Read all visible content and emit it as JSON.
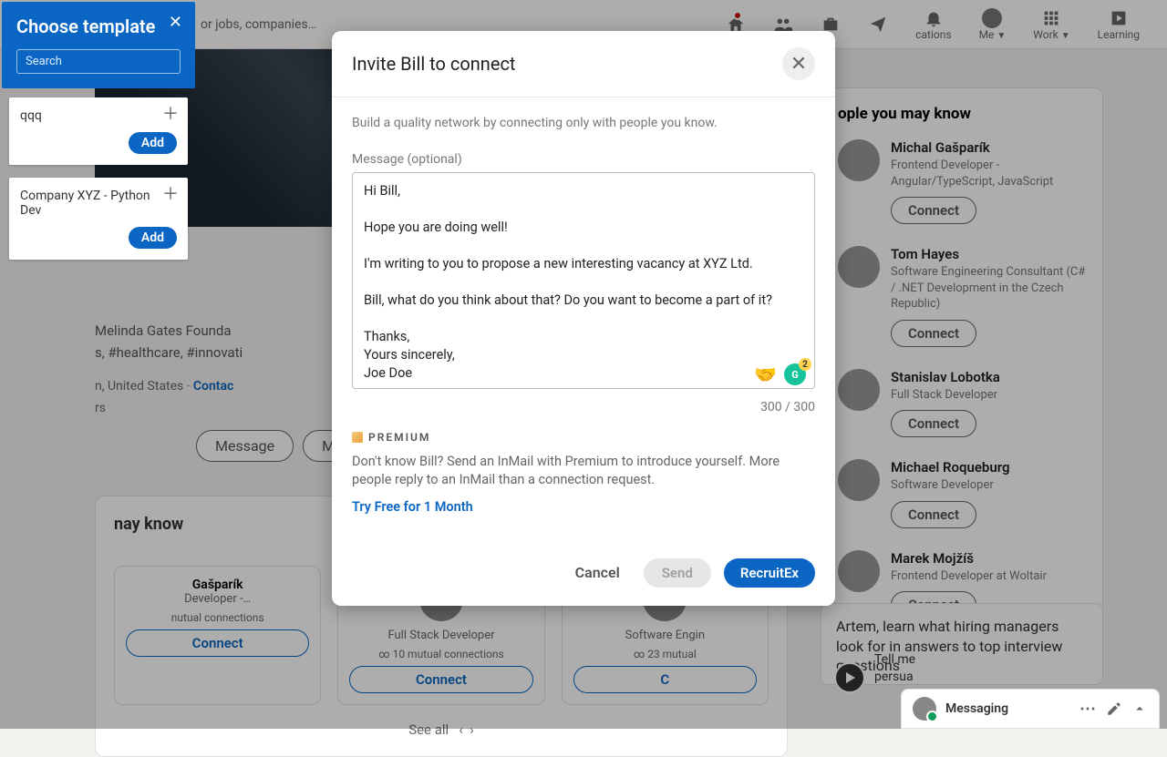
{
  "topnav": {
    "search_hint": "or jobs, companies…",
    "items": [
      "Home",
      "My Network",
      "Jobs",
      "Messaging",
      "Notifications"
    ],
    "me_label": "Me",
    "work_label": "Work",
    "learning_label": "Learning",
    "cations_label": "cations"
  },
  "profile": {
    "org_fragment": "Melinda Gates Founda",
    "tags_fragment": "s, #healthcare, #innovati",
    "location_fragment": "n, United States ·",
    "contact_label": "Contac",
    "rs_fragment": "rs",
    "message_btn": "Message",
    "more_btn": "More"
  },
  "pymk_section": {
    "heading_fragment": "nay know",
    "cards": [
      {
        "name_fragment": "Gašparík",
        "role_fragment": "Developer -…",
        "mutual_fragment": "nutual connections",
        "connect": "Connect"
      },
      {
        "name_fragment": "",
        "role": "Full Stack Developer",
        "mutual": "10 mutual connections",
        "connect": "Connect"
      },
      {
        "name_fragment": "",
        "role": "Software Engin",
        "mutual": "23 mutual",
        "connect": "C"
      }
    ],
    "see_all": "See all"
  },
  "right": {
    "heading": "ople you may know",
    "suggestions": [
      {
        "name": "Michal Gašparík",
        "role": "Frontend Developer - Angular/TypeScript, JavaScript",
        "connect": "Connect"
      },
      {
        "name": "Tom Hayes",
        "role": "Software Engineering Consultant (C# / .NET Development in the Czech Republic)",
        "connect": "Connect"
      },
      {
        "name": "Stanislav Lobotka",
        "role": "Full Stack Developer",
        "connect": "Connect"
      },
      {
        "name": "Michael Roqueburg",
        "role": "Software Developer",
        "connect": "Connect"
      },
      {
        "name": "Marek Mojžíš",
        "role": "Frontend Developer at Woltair",
        "connect": "Connect"
      }
    ]
  },
  "promo": {
    "text": "Artem, learn what hiring managers look for in answers to top interview questions",
    "tell_fragment": "Tell me",
    "persua_fragment": "persua"
  },
  "messaging": {
    "label": "Messaging"
  },
  "templates": {
    "title": "Choose template",
    "search_placeholder": "Search",
    "items": [
      {
        "title": "qqq",
        "add": "Add"
      },
      {
        "title": "Company XYZ - Python Dev",
        "add": "Add"
      }
    ]
  },
  "modal": {
    "title": "Invite Bill to connect",
    "subtitle": "Build a quality network by connecting only with people you know.",
    "message_label": "Message (optional)",
    "message_value": "Hi Bill,\n\nHope you are doing well!\n\nI'm writing to you to propose a new interesting vacancy at XYZ Ltd.\n\nBill, what do you think about that? Do you want to become a part of it?\n\nThanks,\nYours sincerely,\nJoe Doe",
    "counter": "300 / 300",
    "premium_badge": "PREMIUM",
    "premium_text": "Don't know Bill? Send an InMail with Premium to introduce yourself. More people reply to an InMail than a connection request.",
    "premium_link": "Try Free for 1 Month",
    "cancel": "Cancel",
    "send": "Send",
    "recruitex": "RecruitEx"
  }
}
